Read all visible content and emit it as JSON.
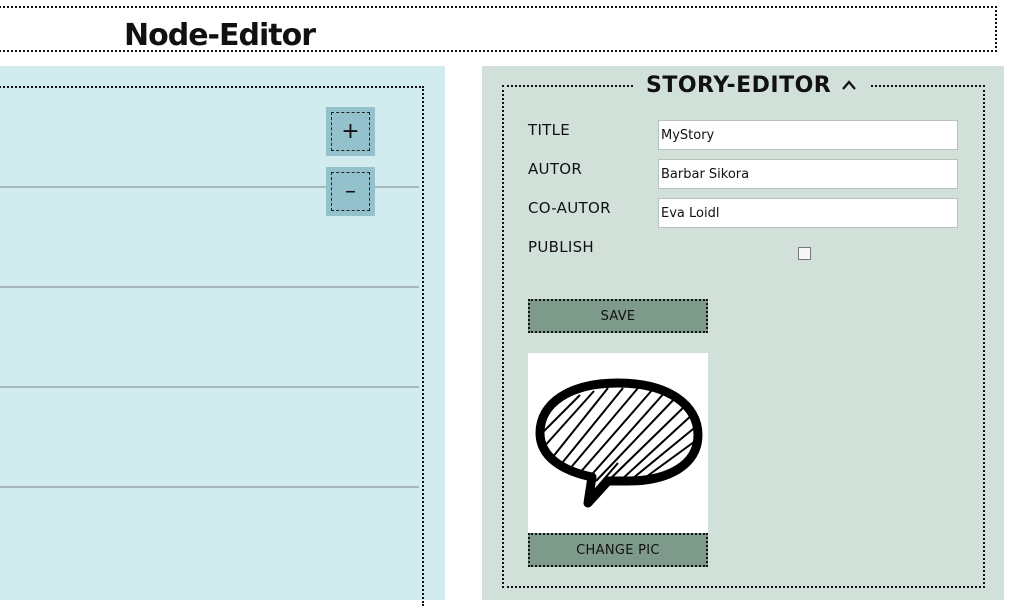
{
  "header": {
    "title": "Node-Editor"
  },
  "node_editor": {
    "zoom_in_label": "+",
    "zoom_out_label": "–"
  },
  "story_editor": {
    "title": "STORY-EDITOR",
    "collapse_icon": "caret-up-icon",
    "fields": {
      "title": {
        "label": "TITLE",
        "value": "MyStory"
      },
      "autor": {
        "label": "AUTOR",
        "value": "Barbar Sikora"
      },
      "co_autor": {
        "label": "CO-AUTOR",
        "value": "Eva Loidl"
      },
      "publish": {
        "label": "PUBLISH",
        "checked": false
      }
    },
    "save_label": "SAVE",
    "picture_icon": "speech-bubble-icon",
    "change_pic_label": "CHANGE PIC"
  },
  "colors": {
    "node_bg": "#d2ebee",
    "story_bg": "#d1e1d9",
    "button_bg": "#7e9a8b",
    "zoom_bg": "#94c2cc"
  }
}
